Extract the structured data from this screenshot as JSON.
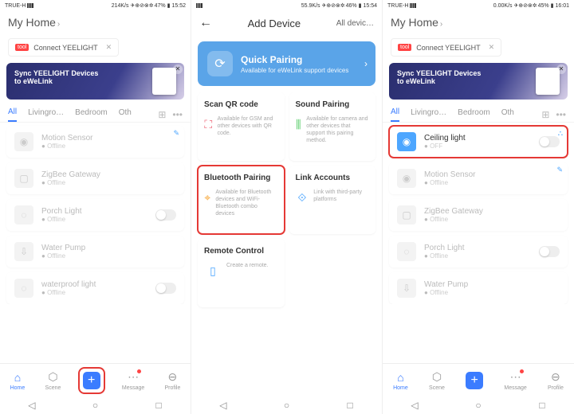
{
  "statusbar": {
    "carrier": "TRUE-H",
    "speed1": "214K/s",
    "speed2": "55.9K/s",
    "speed3": "0.00K/s",
    "battery1": "47%",
    "battery2": "46%",
    "battery3": "45%",
    "time1": "15:52",
    "time2": "15:54",
    "time3": "16:01"
  },
  "home": {
    "title": "My Home",
    "pill_badge": "tool",
    "pill_text": "Connect YEELIGHT",
    "banner_line1": "Sync YEELIGHT Devices",
    "banner_line2": "to eWeLink"
  },
  "tabs": {
    "all": "All",
    "living": "Livingro…",
    "bedroom": "Bedroom",
    "other": "Oth"
  },
  "devices1": [
    {
      "name": "Motion Sensor",
      "status": "Offline"
    },
    {
      "name": "ZigBee Gateway",
      "status": "Offline"
    },
    {
      "name": "Porch Light",
      "status": "Offline"
    },
    {
      "name": "Water Pump",
      "status": "Offline"
    },
    {
      "name": "waterproof light",
      "status": "Offline"
    }
  ],
  "devices3": {
    "ceiling": {
      "name": "Ceiling light",
      "status": "OFF"
    },
    "list": [
      {
        "name": "Motion Sensor",
        "status": "Offline"
      },
      {
        "name": "ZigBee Gateway",
        "status": "Offline"
      },
      {
        "name": "Porch Light",
        "status": "Offline"
      },
      {
        "name": "Water Pump",
        "status": "Offline"
      }
    ]
  },
  "add": {
    "title": "Add Device",
    "all_devices": "All devic…",
    "quick_title": "Quick Pairing",
    "quick_sub": "Available for eWeLink support devices",
    "methods": {
      "qr": {
        "title": "Scan QR code",
        "desc": "Available for GSM and other devices with QR code."
      },
      "sound": {
        "title": "Sound Pairing",
        "desc": "Available for camera and other devices that support this pairing method."
      },
      "bt": {
        "title": "Bluetooth Pairing",
        "desc": "Available for Bluetooth devices and WiFi-Bluetooth combo devices"
      },
      "link": {
        "title": "Link Accounts",
        "desc": "Link with third-party platforms"
      },
      "remote": {
        "title": "Remote Control",
        "desc": "Create a remote."
      }
    }
  },
  "nav": {
    "home": "Home",
    "scene": "Scene",
    "message": "Message",
    "profile": "Profile"
  }
}
